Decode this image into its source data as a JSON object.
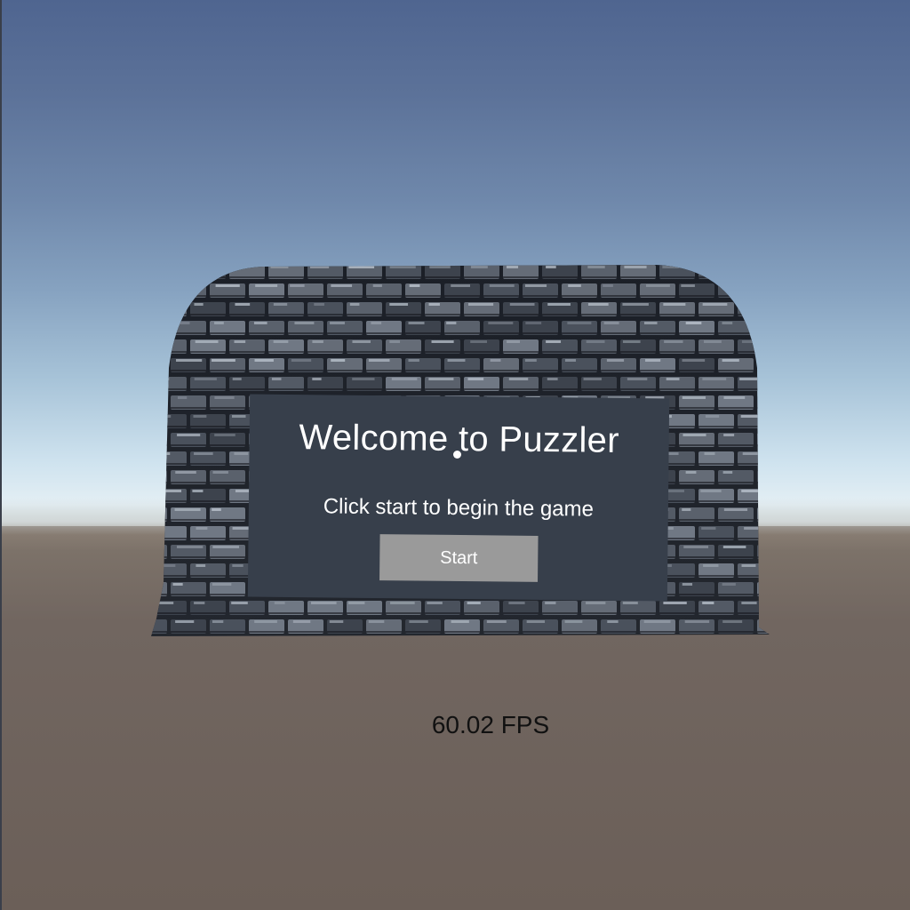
{
  "menu": {
    "title": "Welcome to Puzzler",
    "subtitle": "Click start to begin the game",
    "start_label": "Start"
  },
  "hud": {
    "fps": "60.02 FPS"
  },
  "colors": {
    "panel": "#373f4b",
    "button": "#9a9a9a",
    "sky_top": "#4f6590",
    "ground": "#6b5f58"
  }
}
